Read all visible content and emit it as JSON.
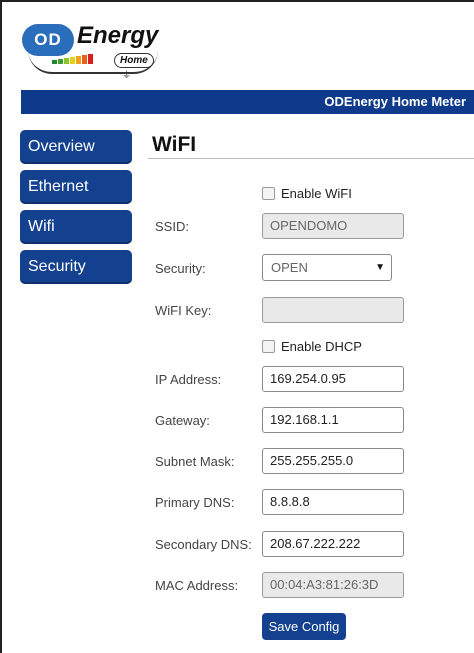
{
  "logo": {
    "od": "OD",
    "brand": "Energy",
    "sub": "Home"
  },
  "banner": {
    "title": "ODEnergy Home Meter"
  },
  "nav": {
    "overview": "Overview",
    "ethernet": "Ethernet",
    "wifi": "Wifi",
    "security": "Security"
  },
  "page": {
    "title": "WiFI"
  },
  "form": {
    "enable_wifi": "Enable WiFI",
    "ssid_label": "SSID:",
    "ssid_value": "OPENDOMO",
    "security_label": "Security:",
    "security_value": "OPEN",
    "wifi_key_label": "WiFI Key:",
    "wifi_key_value": "",
    "enable_dhcp": "Enable DHCP",
    "ip_label": "IP Address:",
    "ip_value": "169.254.0.95",
    "gateway_label": "Gateway:",
    "gateway_value": "192.168.1.1",
    "mask_label": "Subnet Mask:",
    "mask_value": "255.255.255.0",
    "dns1_label": "Primary DNS:",
    "dns1_value": "8.8.8.8",
    "dns2_label": "Secondary DNS:",
    "dns2_value": "208.67.222.222",
    "mac_label": "MAC Address:",
    "mac_value": "00:04:A3:81:26:3D",
    "save_label": "Save Config"
  },
  "colors": {
    "nav_bg": "#13418f",
    "banner_bg": "#0f3a8c",
    "logo_blue": "#2a6ebb"
  },
  "icons": {
    "dropdown": "triangle-down",
    "checkbox": "unchecked-box"
  }
}
